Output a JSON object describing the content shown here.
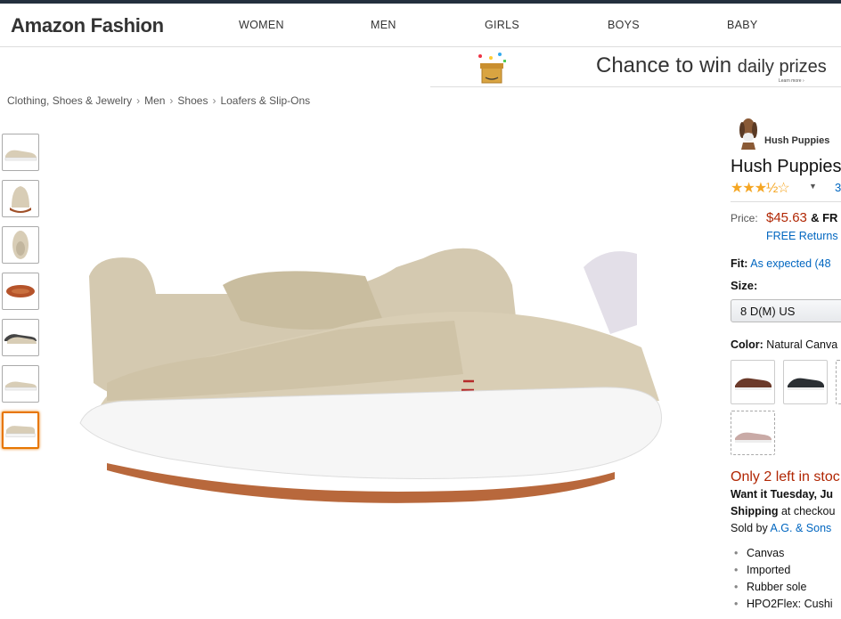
{
  "header": {
    "brand": "Amazon Fashion",
    "nav": [
      "WOMEN",
      "MEN",
      "GIRLS",
      "BOYS",
      "BABY"
    ]
  },
  "promo": {
    "headline": "Chance to win",
    "subline": "daily prizes",
    "learn_more": "Learn more ›"
  },
  "breadcrumb": [
    "Clothing, Shoes & Jewelry",
    "Men",
    "Shoes",
    "Loafers & Slip-Ons"
  ],
  "thumbnails": [
    "side",
    "front",
    "top",
    "sole",
    "pair",
    "back",
    "angled"
  ],
  "active_thumbnail": 6,
  "product": {
    "brand_logo_text": "Hush Puppies",
    "title": "Hush Puppies",
    "stars": "★★★½☆",
    "rating_caret": "▼",
    "review_count": "3",
    "price_label": "Price:",
    "price": "$45.63",
    "price_suffix": "& FR",
    "free_returns": "FREE Returns",
    "fit_label": "Fit:",
    "fit_value": "As expected (48",
    "size_label": "Size:",
    "size_value": "8 D(M) US",
    "color_label": "Color:",
    "color_value": "Natural Canva",
    "stock": "Only 2 left in stoc",
    "want_it": "Want it Tuesday, Ju",
    "shipping_label": "Shipping",
    "shipping_text": "at checkou",
    "sold_by_label": "Sold by",
    "sold_by_value": "A.G. & Sons",
    "features": [
      "Canvas",
      "Imported",
      "Rubber sole",
      "HPO2Flex: Cushi"
    ]
  },
  "colors": {
    "accent": "#e77600",
    "price": "#b12704",
    "link": "#0066c0",
    "header_bar": "#232f3e"
  }
}
